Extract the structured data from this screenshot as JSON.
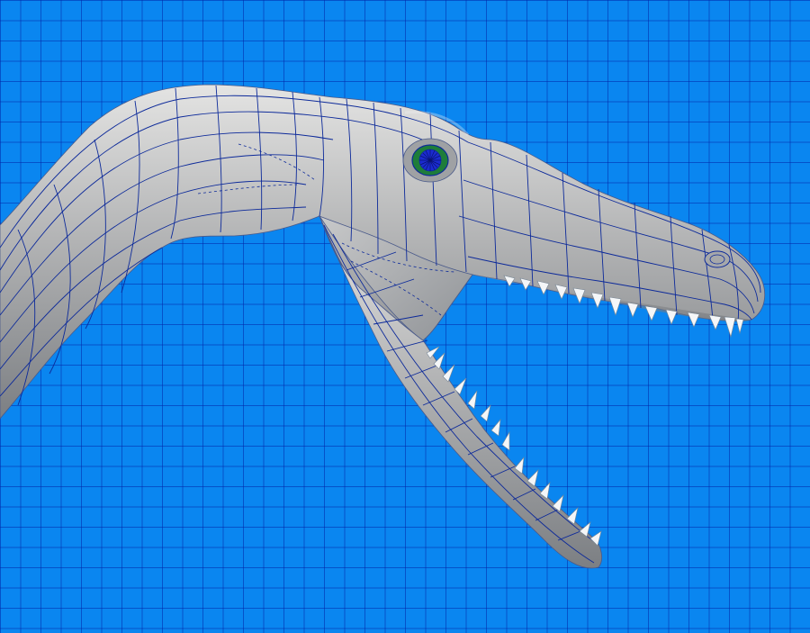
{
  "viewport": {
    "background_color": "#0a86f0",
    "grid_line_color": "#0028aa",
    "mesh_color": "#a9aaab",
    "wireframe_color": "#0d2a9a",
    "eye_iris_color": "#1e7d3a",
    "eye_pupil_color": "#1a2bd0",
    "tooth_color": "#f4f6f8"
  },
  "model": {
    "subject": "dinosaur-head",
    "render_mode": "shaded-with-wireframe",
    "jaw_state": "open"
  }
}
